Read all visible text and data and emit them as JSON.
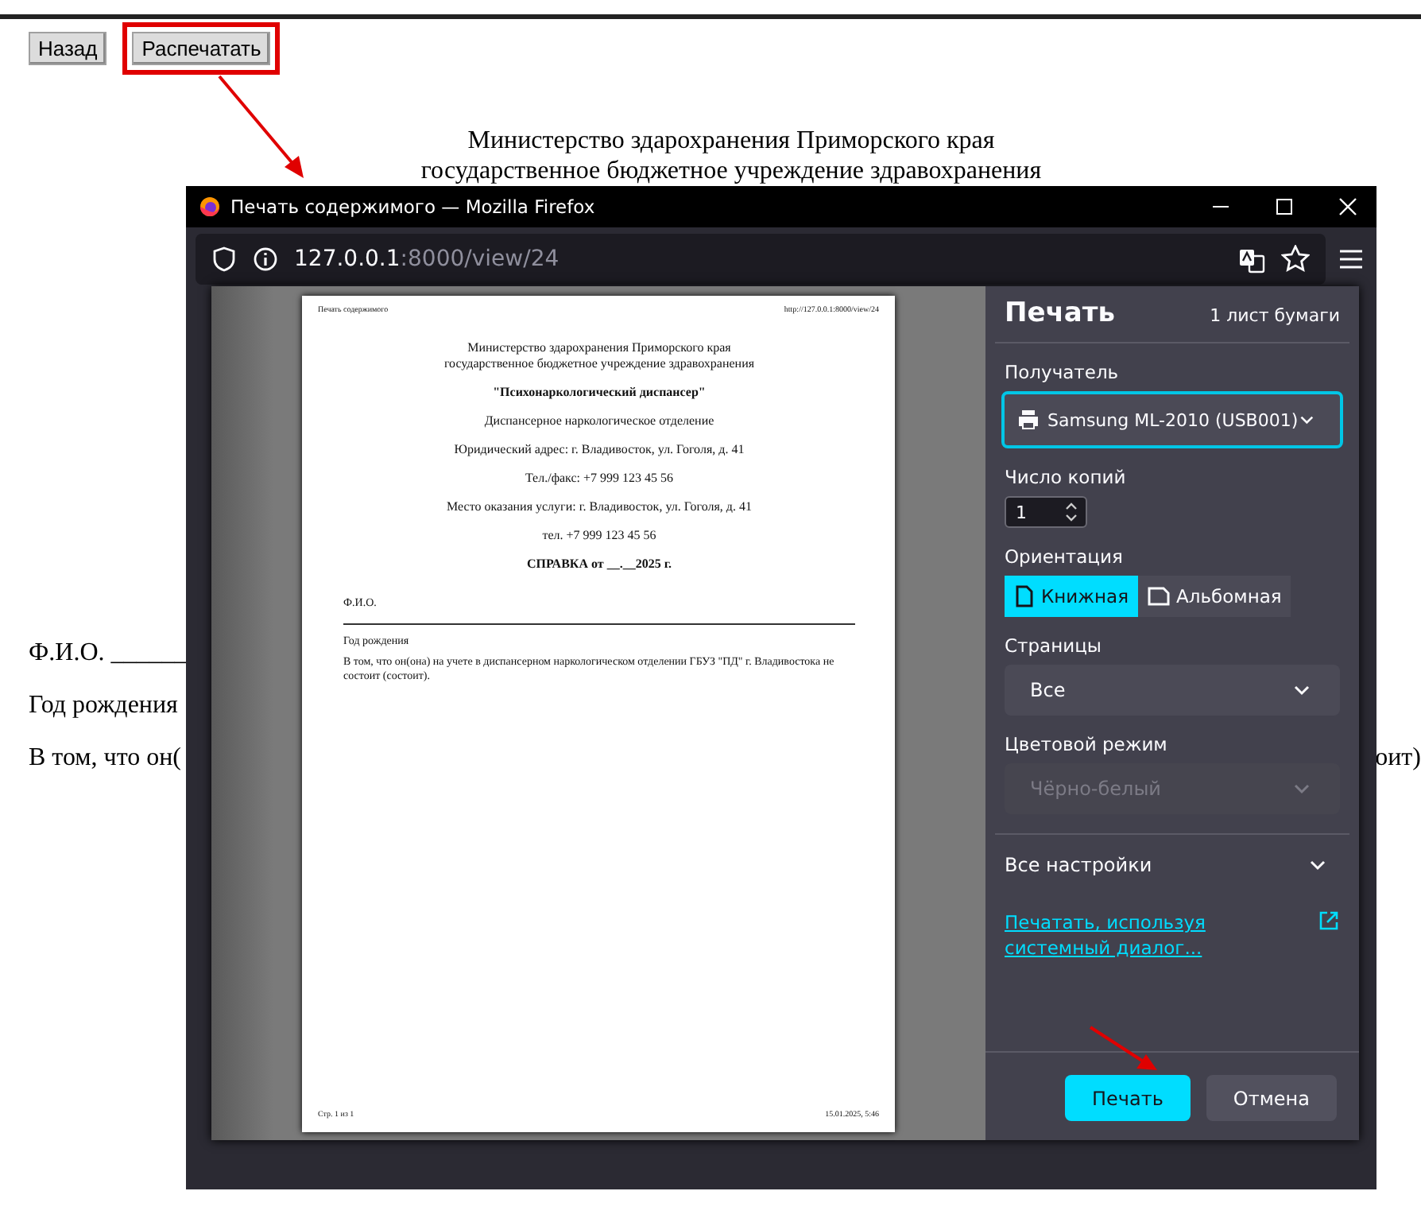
{
  "page": {
    "buttons": [
      {
        "label": "Назад",
        "highlighted": false
      },
      {
        "label": "Распечатать",
        "highlighted": true
      }
    ],
    "header_lines": [
      "Министерство здарохранения Приморского края",
      "государственное бюджетное учреждение здравохранения"
    ],
    "body_lines": [
      "Ф.И.О. ______",
      "Год рождения"
    ],
    "last_line": {
      "start": "В том, что он(",
      "end": "оит)"
    }
  },
  "window": {
    "title": "Печать содержимого — Mozilla Firefox",
    "url_host": "127.0.0.1",
    "url_rest": ":8000/view/24"
  },
  "preview": {
    "header_left": "Печать содержимого",
    "header_right": "http://127.0.0.1:8000/view/24",
    "header_lines": [
      "Министерство здарохранения Приморского края",
      "государственное бюджетное учреждение здравохранения"
    ],
    "lines": [
      {
        "text": "\"Психонаркологический диспансер\"",
        "bold": true
      },
      {
        "text": "Диспансерное наркологическое отделение",
        "bold": false
      },
      {
        "text": "Юридический адрес: г. Владивосток, ул. Гоголя, д. 41",
        "bold": false
      },
      {
        "text": "Тел./факс: +7 999 123 45 56",
        "bold": false
      },
      {
        "text": "Место оказания услуги: г. Владивосток, ул. Гоголя, д. 41",
        "bold": false
      },
      {
        "text": "тел. +7 999 123 45 56",
        "bold": false
      },
      {
        "text": "СПРАВКА от __.__2025 г.",
        "bold": true
      }
    ],
    "fio": "Ф.И.О.",
    "birth": "Год рождения",
    "paragraph": "В том, что он(она) на учете в диспансерном наркологическом отделении ГБУЗ \"ПД\" г. Владивостока не состоит (состоит).",
    "footer_left": "Стр. 1 из 1",
    "footer_right": "15.01.2025, 5:46"
  },
  "settings": {
    "title": "Печать",
    "sheets": "1 лист бумаги",
    "printer_label": "Получатель",
    "printer": "Samsung ML-2010 (USB001)",
    "copies_label": "Число копий",
    "copies": "1",
    "orientation_label": "Ориентация",
    "orientations": [
      {
        "label": "Книжная",
        "kind": "portrait",
        "selected": true
      },
      {
        "label": "Альбомная",
        "kind": "landscape",
        "selected": false
      }
    ],
    "pages_label": "Страницы",
    "pages": "Все",
    "color_label": "Цветовой режим",
    "color_mode": "Чёрно-белый",
    "color_disabled": true,
    "more": "Все настройки",
    "system_link": "Печатать, используя системный диалог...",
    "print_button": "Печать",
    "cancel_button": "Отмена"
  }
}
